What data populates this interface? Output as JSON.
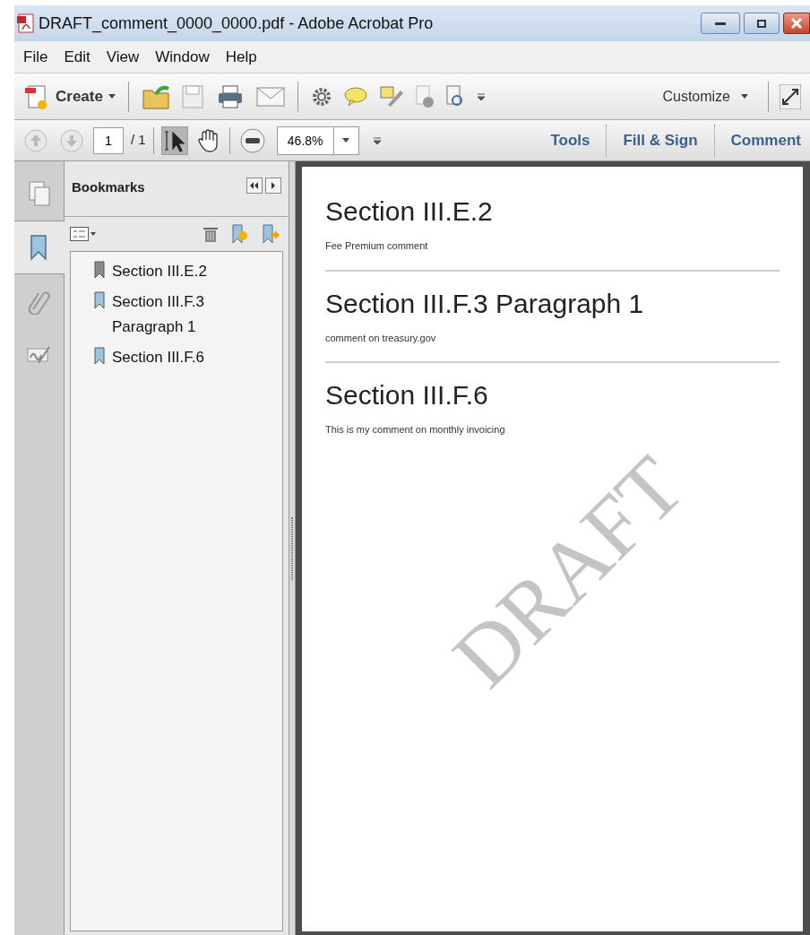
{
  "window": {
    "title": "DRAFT_comment_0000_0000.pdf - Adobe Acrobat Pro"
  },
  "menu": [
    "File",
    "Edit",
    "View",
    "Window",
    "Help"
  ],
  "toolbar": {
    "create": "Create",
    "customize": "Customize"
  },
  "nav": {
    "page": "1",
    "page_total": "/ 1",
    "zoom": "46.8%",
    "tabs": [
      "Tools",
      "Fill & Sign",
      "Comment"
    ]
  },
  "side_tabs": [
    {
      "kind": "pages",
      "selected": false
    },
    {
      "kind": "bookmarks",
      "selected": true
    },
    {
      "kind": "attachments",
      "selected": false
    },
    {
      "kind": "signatures",
      "selected": false
    }
  ],
  "bookmarks_panel": {
    "title": "Bookmarks",
    "items": [
      {
        "label": "Section III.E.2",
        "color": "#8a8a8a"
      },
      {
        "label": "Section III.F.3 Paragraph 1",
        "color": "#9cc3e0"
      },
      {
        "label": "Section III.F.6",
        "color": "#9cc3e0"
      }
    ]
  },
  "document": {
    "sections": [
      {
        "heading": "Section III.E.2",
        "body": "Fee Premium comment"
      },
      {
        "heading": "Section III.F.3 Paragraph 1",
        "body": "comment on treasury.gov"
      },
      {
        "heading": "Section III.F.6",
        "body": "This is my comment on monthly invoicing"
      }
    ],
    "watermark": "DRAFT"
  }
}
